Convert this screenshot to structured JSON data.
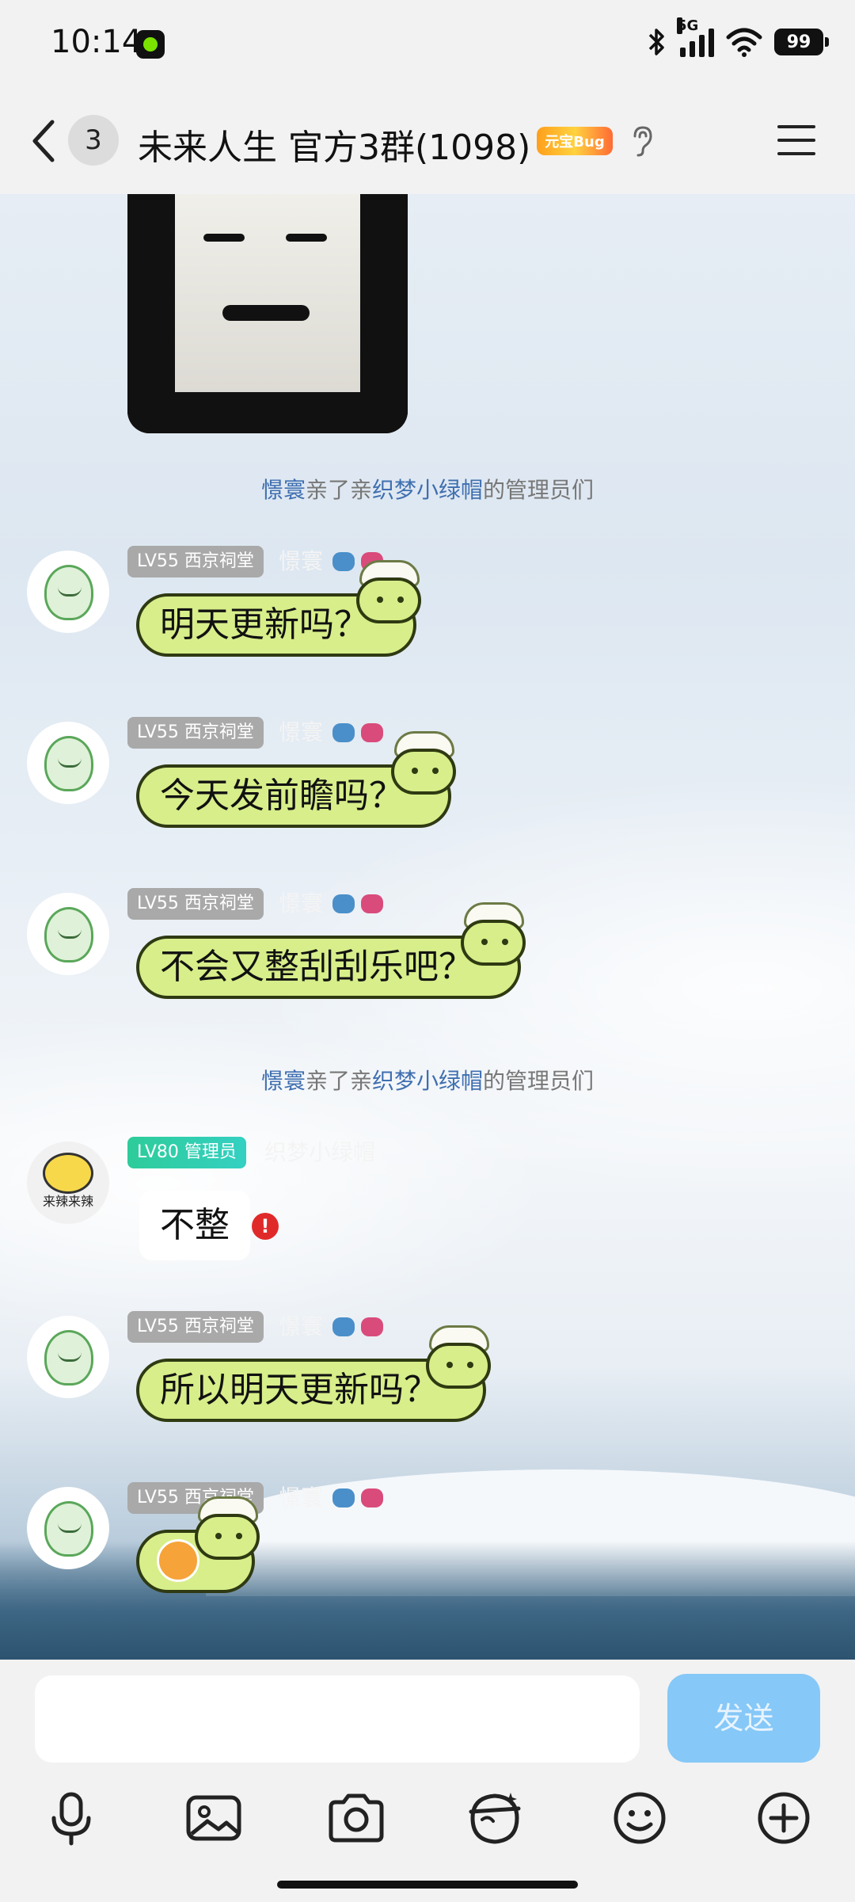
{
  "status_bar": {
    "time": "10:14",
    "network": "5G",
    "battery": "99"
  },
  "header": {
    "unread_count": "3",
    "title": "未来人生 官方3群(1098)",
    "badge_text": "元宝Bug"
  },
  "messages": {
    "m1": {
      "level": "LV55 西京祠堂",
      "nick": "憬寰",
      "text": "明天更新吗？"
    },
    "m2": {
      "level": "LV55 西京祠堂",
      "nick": "憬寰",
      "text": "今天发前瞻吗？"
    },
    "m3": {
      "level": "LV55 西京祠堂",
      "nick": "憬寰",
      "text": "不会又整刮刮乐吧？"
    },
    "m4": {
      "level": "LV80 管理员",
      "nick": "织梦小绿帽",
      "text": "不整",
      "avatar_caption": "来辣来辣"
    },
    "m5": {
      "level": "LV55 西京祠堂",
      "nick": "憬寰",
      "text": "所以明天更新吗？"
    },
    "m6": {
      "level": "LV55 西京祠堂",
      "nick": "憬寰"
    }
  },
  "system_notices": {
    "s1": {
      "actor": "憬寰",
      "verb": "亲了亲",
      "target": "织梦小绿帽",
      "suffix": "的管理员们"
    },
    "s2": {
      "actor": "憬寰",
      "verb": "亲了亲",
      "target": "织梦小绿帽",
      "suffix": "的管理员们"
    }
  },
  "input_bar": {
    "placeholder": "",
    "send_label": "发送"
  },
  "icons": {
    "back": "chevron-left-icon",
    "menu": "hamburger-menu-icon",
    "ear": "ear-icon",
    "mic": "microphone-icon",
    "gallery": "image-icon",
    "camera": "camera-icon",
    "doodle": "face-mask-icon",
    "emoji": "smile-icon",
    "plus": "plus-circle-icon"
  },
  "colors": {
    "bubble_green": "#d7ee8a",
    "send_button": "#86c8f7",
    "link_blue": "#3f6fb0",
    "admin_badge": "#2ecc9a",
    "error_red": "#e02a2a"
  }
}
